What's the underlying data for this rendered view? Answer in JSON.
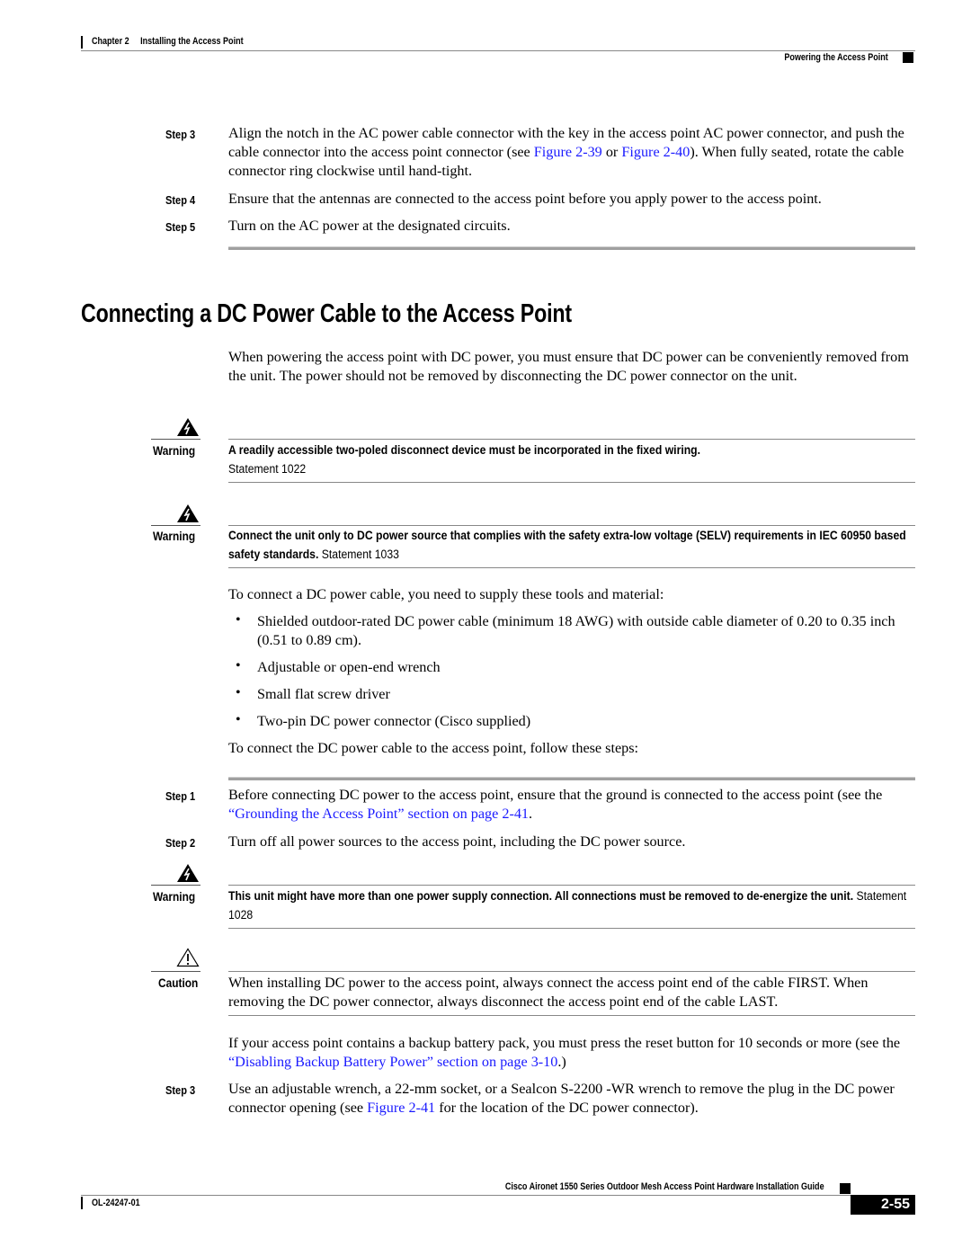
{
  "header": {
    "chapter": "Chapter 2",
    "chapter_title": "Installing the Access Point",
    "section": "Powering the Access Point"
  },
  "ac_steps": [
    {
      "label": "Step 3",
      "pre": "Align the notch in the AC power cable connector with the key in the access point AC power connector, and push the cable connector into the access point connector (see ",
      "link1": "Figure 2-39",
      "mid": " or ",
      "link2": "Figure 2-40",
      "post": "). When fully seated, rotate the cable connector ring clockwise until hand-tight."
    },
    {
      "label": "Step 4",
      "text": "Ensure that the antennas are connected to the access point before you apply power to the access point."
    },
    {
      "label": "Step 5",
      "text": "Turn on the AC power at the designated circuits."
    }
  ],
  "section_title": "Connecting a DC Power Cable to the Access Point",
  "intro": "When powering the access point with DC power, you must ensure that DC power can be conveniently removed from the unit. The power should not be removed by disconnecting the DC power connector on the unit.",
  "warnings": [
    {
      "label": "Warning",
      "bold": "A readily accessible two-poled disconnect device must be incorporated in the fixed wiring.",
      "statement": "Statement 1022"
    },
    {
      "label": "Warning",
      "bold": "Connect the unit only to DC power source that complies with the safety extra-low voltage (SELV) requirements in IEC 60950 based safety standards.",
      "statement": "Statement 1033"
    },
    {
      "label": "Warning",
      "bold": "This unit might have more than one power supply connection. All connections must be removed to de-energize the unit.",
      "statement": "Statement 1028"
    }
  ],
  "tools_intro": "To connect a DC power cable, you need to supply these tools and material:",
  "tools": [
    "Shielded outdoor-rated DC power cable (minimum 18 AWG) with outside cable diameter of 0.20 to 0.35 inch (0.51 to 0.89 cm).",
    "Adjustable or open-end wrench",
    "Small flat screw driver",
    "Two-pin DC power connector (Cisco supplied)"
  ],
  "bullet_glyph": "•",
  "steps_intro": "To connect the DC power cable to the access point, follow these steps:",
  "dc_steps": [
    {
      "label": "Step 1",
      "pre": "Before connecting DC power to the access point, ensure that the ground is connected to the access point (see the ",
      "link": "“Grounding the Access Point” section on page 2-41",
      "post": "."
    },
    {
      "label": "Step 2",
      "text": "Turn off all power sources to the access point, including the DC power source."
    },
    {
      "label": "Step 3",
      "pre": "Use an adjustable wrench, a 22-mm socket, or a Sealcon S-2200 -WR wrench to remove the plug in the DC power connector opening (see ",
      "link": "Figure 2-41",
      "post": " for the location of the DC power connector)."
    }
  ],
  "caution": {
    "label": "Caution",
    "text": "When installing DC power to the access point, always connect the access point end of the cable FIRST. When removing the DC power connector, always disconnect the access point end of the cable LAST."
  },
  "battery_note": {
    "pre": "If your access point contains a backup battery pack, you must press the reset button for 10 seconds or more (see the ",
    "link": "“Disabling Backup Battery Power” section on page 3-10",
    "post": ".)"
  },
  "footer": {
    "guide_title": "Cisco Aironet 1550 Series Outdoor Mesh Access Point Hardware Installation Guide",
    "doc_number": "OL-24247-01",
    "page_number": "2-55"
  },
  "colors": {
    "link": "#1a1aff",
    "rule": "#a0a0a0"
  }
}
